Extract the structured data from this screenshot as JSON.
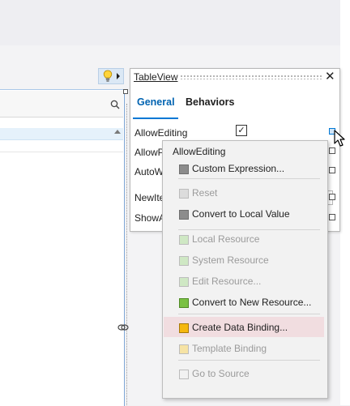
{
  "panel": {
    "title": "TableView",
    "tabs": [
      {
        "label": "General",
        "active": true
      },
      {
        "label": "Behaviors",
        "active": false
      }
    ],
    "properties": [
      {
        "label": "AllowEditing",
        "checked": true
      },
      {
        "label": "AllowP"
      },
      {
        "label": "AutoW"
      },
      {
        "label": "NewIte"
      },
      {
        "label": "ShowA"
      }
    ]
  },
  "menu": {
    "header": "AllowEditing",
    "items": [
      {
        "label": "Custom Expression...",
        "enabled": true,
        "color": "#8c8c8c"
      },
      {
        "label": "Reset",
        "enabled": false,
        "color": "#dcdcdc"
      },
      {
        "label": "Convert to Local Value",
        "enabled": true,
        "color": "#8c8c8c"
      },
      {
        "label": "Local Resource",
        "enabled": false,
        "color": "#cfe8c4"
      },
      {
        "label": "System Resource",
        "enabled": false,
        "color": "#cfe8c4"
      },
      {
        "label": "Edit Resource...",
        "enabled": false,
        "color": "#cfe8c4"
      },
      {
        "label": "Convert to New Resource...",
        "enabled": true,
        "color": "#7ac143"
      },
      {
        "label": "Create Data Binding...",
        "enabled": true,
        "color": "#f5b80f",
        "hovered": true
      },
      {
        "label": "Template Binding",
        "enabled": false,
        "color": "#f6e3a4"
      },
      {
        "label": "Go to Source",
        "enabled": false,
        "color": "#f2f2f2"
      }
    ]
  },
  "colors": {
    "accent": "#0078d4",
    "hover": "#f1dde0"
  },
  "icons": [
    "lightbulb-icon",
    "search-icon",
    "close-icon",
    "check-icon",
    "mouse-cursor-icon",
    "link-icon"
  ]
}
